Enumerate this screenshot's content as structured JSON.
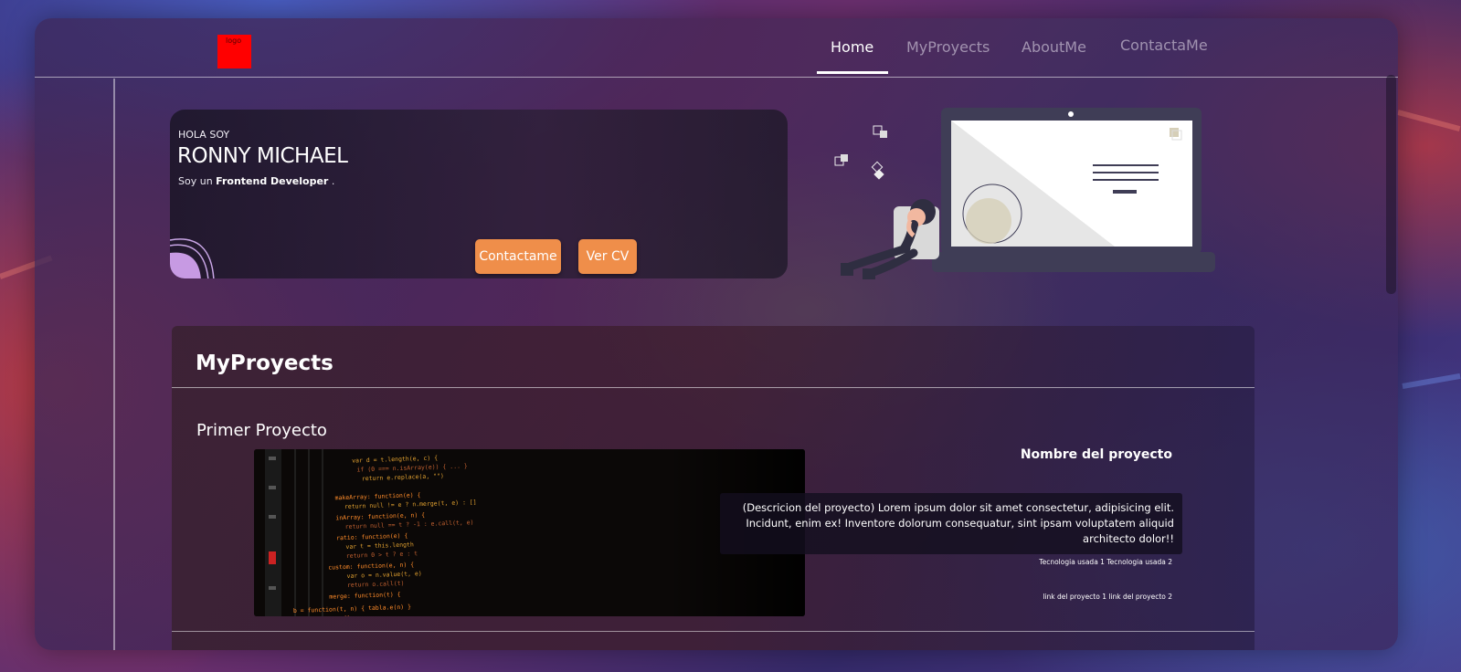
{
  "nav": {
    "logo_text": "logo",
    "items": [
      {
        "label": "Home",
        "active": true
      },
      {
        "label": "MyProyects",
        "active": false
      },
      {
        "label": "AboutMe",
        "active": false
      },
      {
        "label": "ContactaMe",
        "active": false
      }
    ]
  },
  "hero": {
    "greeting": "HOLA SOY",
    "name": "RONNY MICHAEL",
    "subtitle_prefix": "Soy un ",
    "subtitle_role": "Frontend Developer",
    "subtitle_suffix": " .",
    "contact_button": "Contactame",
    "cv_button": "Ver CV"
  },
  "projects": {
    "section_title": "MyProyects",
    "items": [
      {
        "title": "Primer Proyecto",
        "name": "Nombre del proyecto",
        "description": "(Descricion del proyecto) Lorem ipsum dolor sit amet consectetur, adipisicing elit. Incidunt, enim ex! Inventore dolorum consequatur, sint ipsam voluptatem aliquid architecto dolor!!",
        "technologies": "Tecnologia usada 1 Tecnologia usada 2",
        "links": "link del proyecto 1 link del proyecto 2"
      }
    ]
  },
  "colors": {
    "accent_button": "#ef8e4a",
    "logo": "#ff0000",
    "text": "#ffffff"
  }
}
